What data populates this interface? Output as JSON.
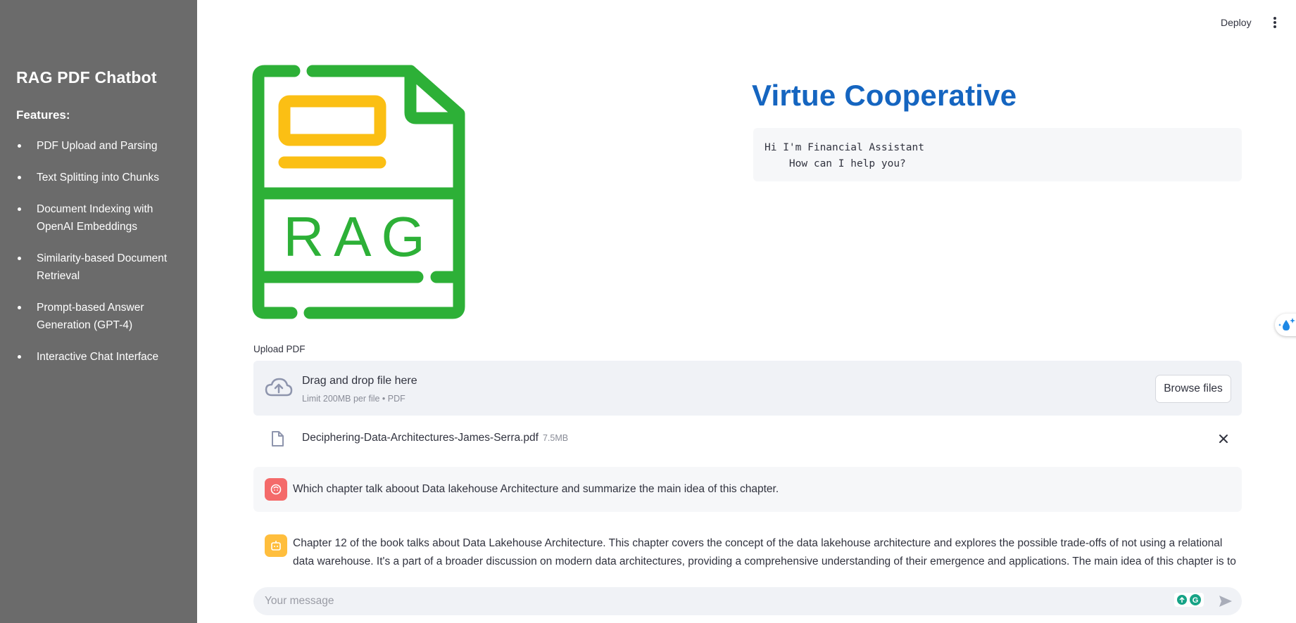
{
  "sidebar": {
    "title": "RAG PDF Chatbot",
    "features_heading": "Features:",
    "features": [
      "PDF Upload and Parsing",
      "Text Splitting into Chunks",
      "Document Indexing with OpenAI Embeddings",
      "Similarity-based Document Retrieval",
      "Prompt-based Answer Generation (GPT-4)",
      "Interactive Chat Interface"
    ]
  },
  "toolbar": {
    "deploy_label": "Deploy",
    "menu_icon": "vertical-dots-icon"
  },
  "logo": {
    "text": "RAG",
    "colors": {
      "green": "#2db037",
      "yellow": "#fbbf14"
    }
  },
  "header": {
    "title": "Virtue Cooperative",
    "greeting": "Hi I'm Financial Assistant\n    How can I help you?"
  },
  "upload": {
    "label": "Upload PDF",
    "drop_title": "Drag and drop file here",
    "drop_limit": "Limit 200MB per file • PDF",
    "browse_label": "Browse files",
    "file_name": "Deciphering-Data-Architectures-James-Serra.pdf",
    "file_size": "7.5MB"
  },
  "chat": {
    "messages": [
      {
        "role": "user",
        "text": "Which chapter talk aboout Data lakehouse Architecture and summarize the main idea of this chapter."
      },
      {
        "role": "assistant",
        "text": "Chapter 12 of the book talks about Data Lakehouse Architecture. This chapter covers the concept of the data lakehouse architecture and explores the possible trade-offs of not using a relational data warehouse. It's a part of a broader discussion on modern data architectures, providing a comprehensive understanding of their emergence and applications. The main idea of this chapter is to introduce"
      }
    ],
    "input_placeholder": "Your message"
  },
  "colors": {
    "sidebar_bg": "#6b6b6b",
    "title_blue": "#1565c0",
    "user_avatar": "#f46a6a",
    "bot_avatar": "#ffbe3d"
  }
}
